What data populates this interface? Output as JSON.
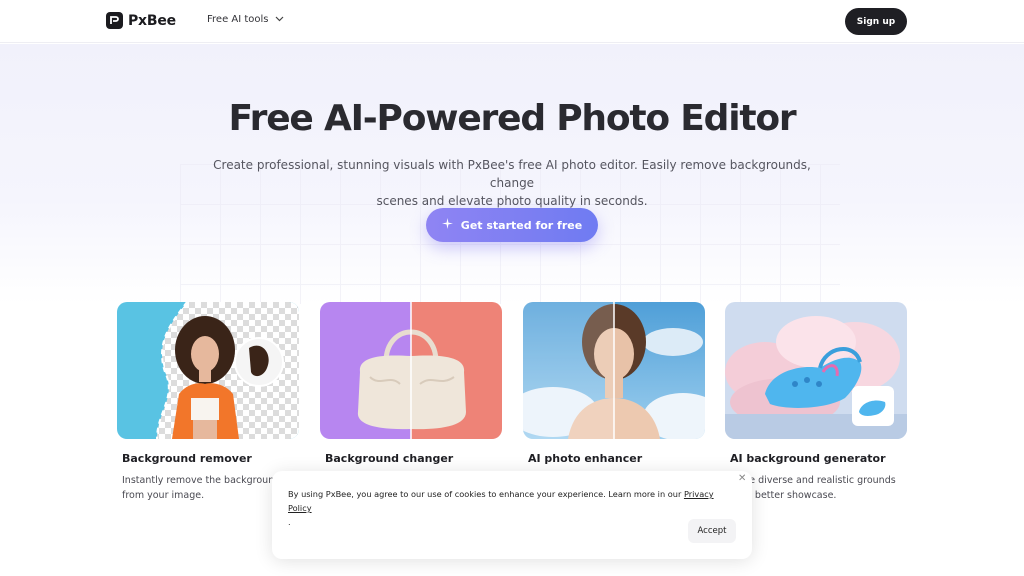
{
  "header": {
    "brand": "PxBee",
    "nav_tools": "Free AI tools",
    "signup": "Sign up"
  },
  "hero": {
    "title": "Free AI-Powered Photo Editor",
    "subtitle_line1": "Create professional, stunning visuals with PxBee's free AI photo editor. Easily remove backgrounds, change",
    "subtitle_line2": "scenes and elevate photo quality in seconds.",
    "cta": "Get started for free"
  },
  "cards": [
    {
      "title": "Background remover",
      "desc": "Instantly remove the background from your image."
    },
    {
      "title": "Background changer",
      "desc": ""
    },
    {
      "title": "AI photo enhancer",
      "desc": ""
    },
    {
      "title": "AI background generator",
      "desc": "erate diverse and realistic grounds for a better showcase."
    }
  ],
  "cookie": {
    "text": "By using PxBee, you agree to our use of cookies to enhance your experience. Learn more in our",
    "link": "Privacy Policy",
    "period": ".",
    "accept": "Accept"
  },
  "colors": {
    "accent_gradient_start": "#8f84f3",
    "accent_gradient_end": "#6f7bf2",
    "dark": "#1f1f24"
  }
}
